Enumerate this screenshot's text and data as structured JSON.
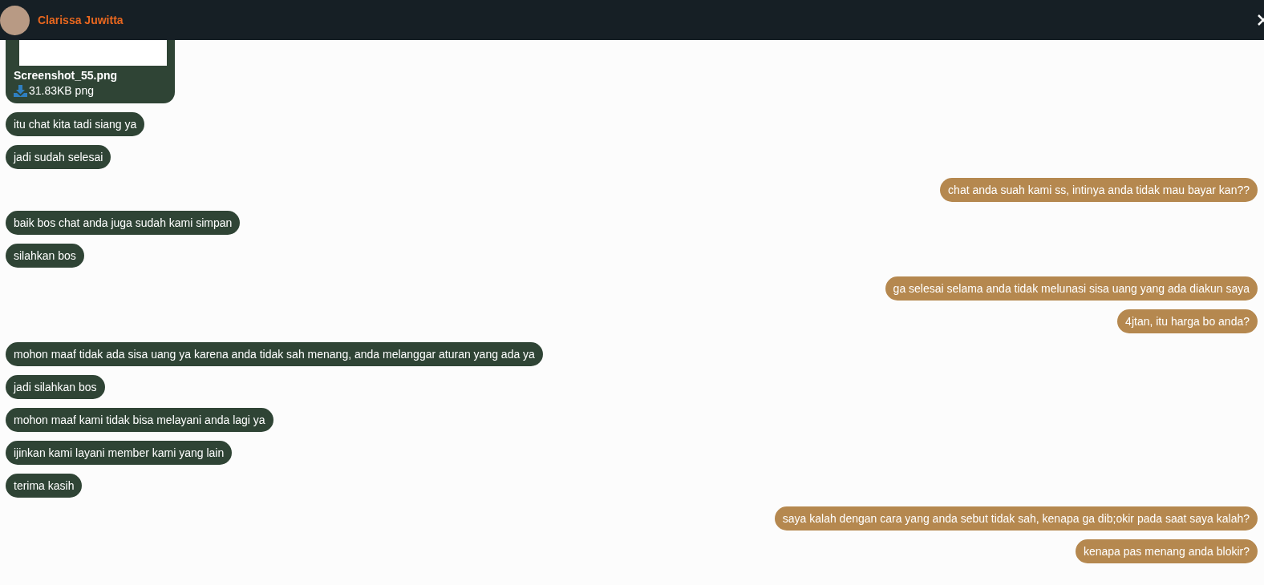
{
  "header": {
    "contact_name": "Clarissa Juwitta"
  },
  "attachment": {
    "filename": "Screenshot_55.png",
    "size": "31.83KB png"
  },
  "messages": [
    {
      "text": "itu chat kita tadi siang ya",
      "outgoing": false
    },
    {
      "text": "jadi sudah selesai",
      "outgoing": false
    },
    {
      "text": "chat anda suah kami ss, intinya anda tidak mau bayar kan??",
      "outgoing": true
    },
    {
      "text": "baik bos chat anda juga sudah kami simpan",
      "outgoing": false
    },
    {
      "text": "silahkan bos",
      "outgoing": false
    },
    {
      "text": "ga selesai selama anda tidak melunasi sisa uang yang ada diakun saya",
      "outgoing": true
    },
    {
      "text": "4jtan, itu harga bo anda?",
      "outgoing": true
    },
    {
      "text": "mohon maaf tidak ada sisa uang ya karena anda tidak sah menang, anda melanggar aturan yang ada ya",
      "outgoing": false
    },
    {
      "text": "jadi silahkan bos",
      "outgoing": false
    },
    {
      "text": "mohon maaf kami tidak bisa melayani anda lagi ya",
      "outgoing": false
    },
    {
      "text": "ijinkan kami layani member kami yang lain",
      "outgoing": false
    },
    {
      "text": "terima kasih",
      "outgoing": false
    },
    {
      "text": "saya kalah dengan cara yang anda sebut tidak sah, kenapa ga dib;okir pada saat saya kalah?",
      "outgoing": true
    },
    {
      "text": "kenapa pas menang anda blokir?",
      "outgoing": true
    }
  ]
}
